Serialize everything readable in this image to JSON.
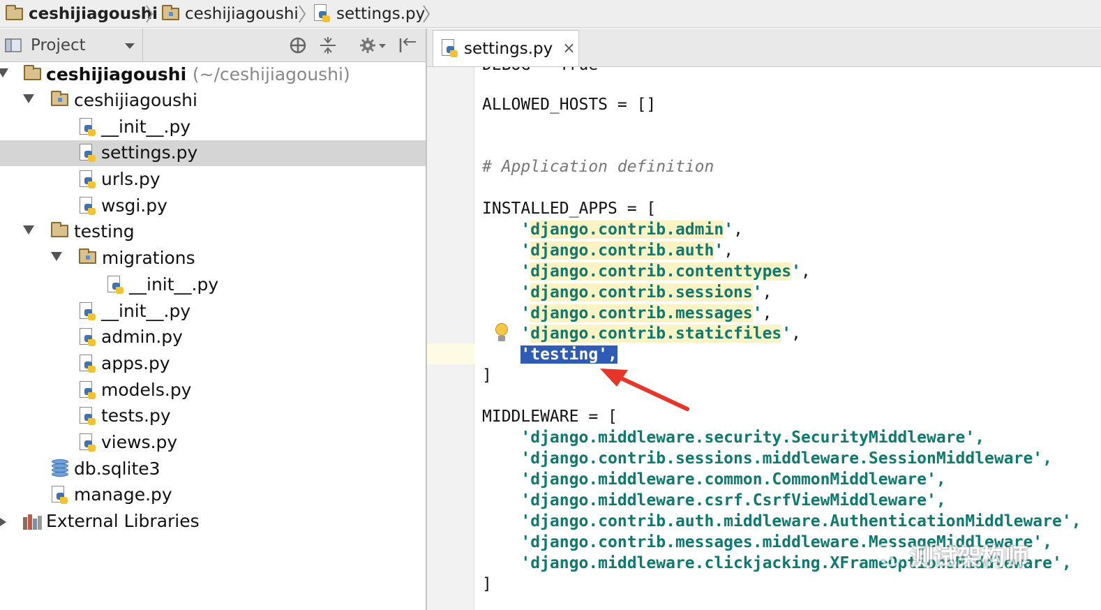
{
  "breadcrumb": {
    "items": [
      {
        "label": "ceshijiagoushi",
        "icon": "folder-icon"
      },
      {
        "label": "ceshijiagoushi",
        "icon": "package-folder-icon"
      },
      {
        "label": "settings.py",
        "icon": "python-file-icon"
      }
    ]
  },
  "project_panel": {
    "view_label": "Project",
    "toolbar_icons": [
      "locate-icon",
      "collapse-all-icon",
      "gear-icon",
      "hide-panel-icon"
    ]
  },
  "tree": {
    "root_label": "ceshijiagoushi",
    "root_path": "(~/ceshijiagoushi)",
    "items": [
      {
        "label": "ceshijiagoushi",
        "icon": "package-folder-icon",
        "expanded": true
      },
      {
        "label": "__init__.py",
        "icon": "python-file-icon"
      },
      {
        "label": "settings.py",
        "icon": "python-file-icon",
        "selected": true
      },
      {
        "label": "urls.py",
        "icon": "python-file-icon"
      },
      {
        "label": "wsgi.py",
        "icon": "python-file-icon"
      },
      {
        "label": "testing",
        "icon": "folder-icon",
        "expanded": true
      },
      {
        "label": "migrations",
        "icon": "package-folder-icon",
        "expanded": true
      },
      {
        "label": "__init__.py",
        "icon": "python-file-icon"
      },
      {
        "label": "__init__.py",
        "icon": "python-file-icon"
      },
      {
        "label": "admin.py",
        "icon": "python-file-icon"
      },
      {
        "label": "apps.py",
        "icon": "python-file-icon"
      },
      {
        "label": "models.py",
        "icon": "python-file-icon"
      },
      {
        "label": "tests.py",
        "icon": "python-file-icon"
      },
      {
        "label": "views.py",
        "icon": "python-file-icon"
      },
      {
        "label": "db.sqlite3",
        "icon": "database-icon"
      },
      {
        "label": "manage.py",
        "icon": "python-file-icon"
      }
    ],
    "external_libraries": "External Libraries"
  },
  "editor": {
    "tab_label": "settings.py",
    "tab_close": "×",
    "lines": {
      "top_partial": "DEBUG = True",
      "allowed_hosts": "ALLOWED_HOSTS = []",
      "comment": "# Application definition",
      "installed_apps_open": "INSTALLED_APPS = [",
      "apps": [
        "django.contrib.admin",
        "django.contrib.auth",
        "django.contrib.contenttypes",
        "django.contrib.sessions",
        "django.contrib.messages",
        "django.contrib.staticfiles"
      ],
      "selected_line": "'testing',",
      "close_bracket": "]",
      "middleware_open": "MIDDLEWARE = [",
      "middleware": [
        "'django.middleware.security.SecurityMiddleware',",
        "'django.contrib.sessions.middleware.SessionMiddleware',",
        "'django.middleware.common.CommonMiddleware',",
        "'django.middleware.csrf.CsrfViewMiddleware',",
        "'django.contrib.auth.middleware.AuthenticationMiddleware',",
        "'django.contrib.messages.middleware.MessageMiddleware',",
        "'django.middleware.clickjacking.XFrameOptionsMiddleware',"
      ]
    }
  },
  "watermark": {
    "text": "测试架构师"
  },
  "colors": {
    "string": "#0d7a6f",
    "selection": "#2d5bb5",
    "arrow": "#e8352a",
    "caret_line": "#fdfbe4"
  }
}
